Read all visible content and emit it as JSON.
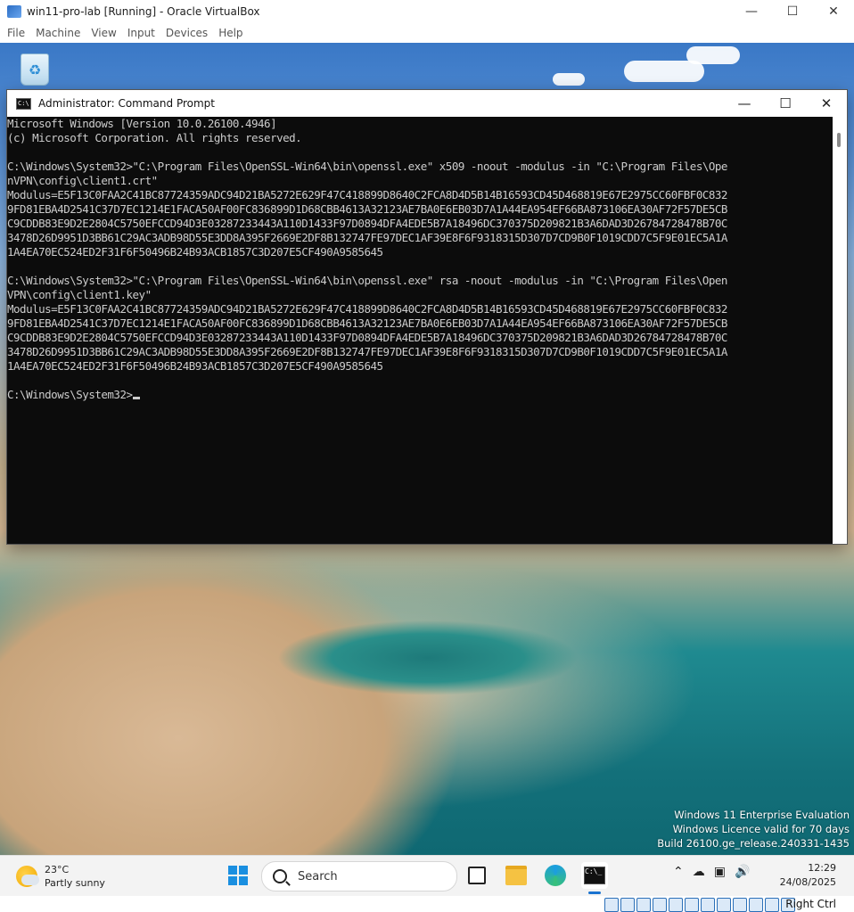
{
  "vbox": {
    "title": "win11-pro-lab [Running] - Oracle VirtualBox",
    "menu": [
      "File",
      "Machine",
      "View",
      "Input",
      "Devices",
      "Help"
    ],
    "host_key": "Right Ctrl"
  },
  "cmd": {
    "title": "Administrator: Command Prompt",
    "lines": [
      "Microsoft Windows [Version 10.0.26100.4946]",
      "(c) Microsoft Corporation. All rights reserved.",
      "",
      "C:\\Windows\\System32>\"C:\\Program Files\\OpenSSL-Win64\\bin\\openssl.exe\" x509 -noout -modulus -in \"C:\\Program Files\\Ope",
      "nVPN\\config\\client1.crt\"",
      "Modulus=E5F13C0FAA2C41BC87724359ADC94D21BA5272E629F47C418899D8640C2FCA8D4D5B14B16593CD45D468819E67E2975CC60FBF0C832",
      "9FD81EBA4D2541C37D7EC1214E1FACA50AF00FC836899D1D68CBB4613A32123AE7BA0E6EB03D7A1A44EA954EF66BA873106EA30AF72F57DE5CB",
      "C9CDDB83E9D2E2804C5750EFCCD94D3E03287233443A110D1433F97D0894DFA4EDE5B7A18496DC370375D209821B3A6DAD3D26784728478B70C",
      "3478D26D9951D3BB61C29AC3ADB98D55E3DD8A395F2669E2DF8B132747FE97DEC1AF39E8F6F9318315D307D7CD9B0F1019CDD7C5F9E01EC5A1A",
      "1A4EA70EC524ED2F31F6F50496B24B93ACB1857C3D207E5CF490A9585645",
      "",
      "C:\\Windows\\System32>\"C:\\Program Files\\OpenSSL-Win64\\bin\\openssl.exe\" rsa -noout -modulus -in \"C:\\Program Files\\Open",
      "VPN\\config\\client1.key\"",
      "Modulus=E5F13C0FAA2C41BC87724359ADC94D21BA5272E629F47C418899D8640C2FCA8D4D5B14B16593CD45D468819E67E2975CC60FBF0C832",
      "9FD81EBA4D2541C37D7EC1214E1FACA50AF00FC836899D1D68CBB4613A32123AE7BA0E6EB03D7A1A44EA954EF66BA873106EA30AF72F57DE5CB",
      "C9CDDB83E9D2E2804C5750EFCCD94D3E03287233443A110D1433F97D0894DFA4EDE5B7A18496DC370375D209821B3A6DAD3D26784728478B70C",
      "3478D26D9951D3BB61C29AC3ADB98D55E3DD8A395F2669E2DF8B132747FE97DEC1AF39E8F6F9318315D307D7CD9B0F1019CDD7C5F9E01EC5A1A",
      "1A4EA70EC524ED2F31F6F50496B24B93ACB1857C3D207E5CF490A9585645",
      ""
    ],
    "prompt": "C:\\Windows\\System32>"
  },
  "watermark": {
    "line1": "Windows 11 Enterprise Evaluation",
    "line2": "Windows Licence valid for 70 days",
    "line3": "Build 26100.ge_release.240331-1435"
  },
  "taskbar": {
    "weather_temp": "23°C",
    "weather_desc": "Partly sunny",
    "search_label": "Search",
    "time": "12:29",
    "date": "24/08/2025"
  },
  "colors": {
    "console_bg": "#0c0c0c",
    "console_fg": "#cccccc",
    "accent": "#1a73d0"
  }
}
